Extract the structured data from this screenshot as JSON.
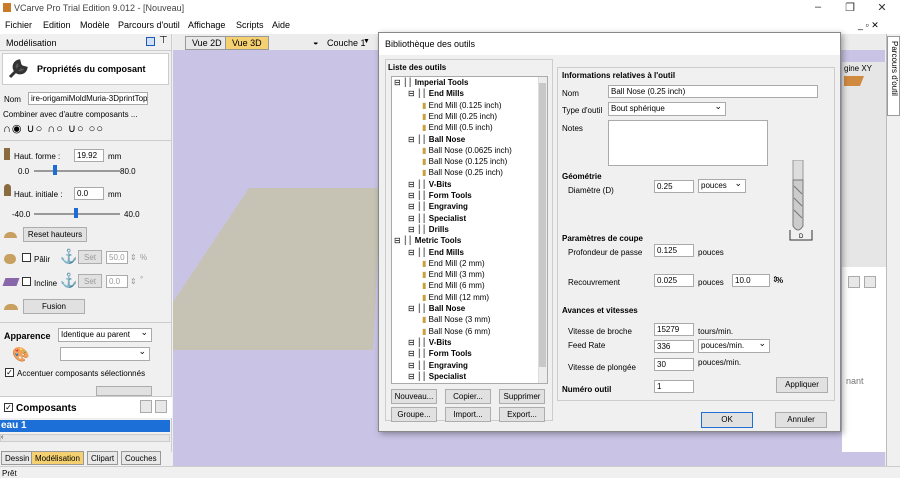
{
  "app": {
    "title": "VCarve Pro Trial Edition 9.012 - [Nouveau]",
    "status": "Prêt"
  },
  "menu": [
    "Fichier",
    "Edition",
    "Modèle",
    "Parcours d'outil",
    "Affichage",
    "Scripts",
    "Aide"
  ],
  "left": {
    "header": "Modélisation",
    "props_title": "Propriétés du composant",
    "name_label": "Nom",
    "name_value": "ire-origamiMoldMuria-3DprintTop",
    "combine_label": "Combiner avec d'autre composants ...",
    "haut_forme_label": "Haut. forme :",
    "haut_forme": "19.92",
    "unit_mm": "mm",
    "slider1_min": "0.0",
    "slider1_max": "80.0",
    "haut_init_label": "Haut. initiale :",
    "haut_init": "0.0",
    "slider2_min": "-40.0",
    "slider2_max": "40.0",
    "reset_label": "Reset hauteurs",
    "palier_label": "Pâlir",
    "set": "Set",
    "palier_val": "50.0",
    "pct": "%",
    "incline_label": "Incline",
    "incline_val": "0.0",
    "deg": "°",
    "fusion": "Fusion",
    "apparence_label": "Apparence",
    "apparence_value": "Identique au parent",
    "accent_label": "Accentuer composants sélectionnés",
    "composants_label": "Composants",
    "niveau": "eau 1",
    "tabs": [
      "Dessin",
      "Modélisation",
      "Clipart",
      "Couches"
    ]
  },
  "view": {
    "tab2d": "Vue 2D",
    "tab3d": "Vue 3D",
    "couche": "Couche 1",
    "right_label": "gine XY",
    "right_text": "nant",
    "right_tab": "Parcours d'outil"
  },
  "dialog": {
    "title": "Bibliothèque des outils",
    "list_title": "Liste des outils",
    "tree": [
      {
        "t": "Imperial Tools",
        "lvl": 0,
        "bold": true
      },
      {
        "t": "End Mills",
        "lvl": 1,
        "bold": true
      },
      {
        "t": "End Mill (0.125 inch)",
        "lvl": 2
      },
      {
        "t": "End Mill (0.25 inch)",
        "lvl": 2
      },
      {
        "t": "End Mill (0.5 inch)",
        "lvl": 2
      },
      {
        "t": "Ball Nose",
        "lvl": 1,
        "bold": true
      },
      {
        "t": "Ball Nose (0.0625 inch)",
        "lvl": 2
      },
      {
        "t": "Ball Nose (0.125 inch)",
        "lvl": 2
      },
      {
        "t": "Ball Nose (0.25 inch)",
        "lvl": 2
      },
      {
        "t": "V-Bits",
        "lvl": 1,
        "bold": true
      },
      {
        "t": "Form Tools",
        "lvl": 1,
        "bold": true
      },
      {
        "t": "Engraving",
        "lvl": 1,
        "bold": true
      },
      {
        "t": "Specialist",
        "lvl": 1,
        "bold": true
      },
      {
        "t": "Drills",
        "lvl": 1,
        "bold": true
      },
      {
        "t": "Metric Tools",
        "lvl": 0,
        "bold": true
      },
      {
        "t": "End Mills",
        "lvl": 1,
        "bold": true
      },
      {
        "t": "End Mill (2 mm)",
        "lvl": 2
      },
      {
        "t": "End Mill (3 mm)",
        "lvl": 2
      },
      {
        "t": "End Mill (6 mm)",
        "lvl": 2
      },
      {
        "t": "End Mill (12 mm)",
        "lvl": 2
      },
      {
        "t": "Ball Nose",
        "lvl": 1,
        "bold": true
      },
      {
        "t": "Ball Nose (3 mm)",
        "lvl": 2
      },
      {
        "t": "Ball Nose (6 mm)",
        "lvl": 2
      },
      {
        "t": "V-Bits",
        "lvl": 1,
        "bold": true
      },
      {
        "t": "Form Tools",
        "lvl": 1,
        "bold": true
      },
      {
        "t": "Engraving",
        "lvl": 1,
        "bold": true
      },
      {
        "t": "Specialist",
        "lvl": 1,
        "bold": true
      }
    ],
    "buttons": {
      "nouveau": "Nouveau...",
      "copier": "Copier...",
      "supprimer": "Supprimer",
      "groupe": "Groupe...",
      "import": "Import...",
      "export": "Export...",
      "ok": "OK",
      "annuler": "Annuler",
      "appliquer": "Appliquer"
    },
    "info_title": "Informations relatives à l'outil",
    "nom_label": "Nom",
    "nom": "Ball Nose (0.25 inch)",
    "type_label": "Type d'outil",
    "type": "Bout sphérique",
    "notes_label": "Notes",
    "geo_title": "Géométrie",
    "diam_label": "Diamètre (D)",
    "diam": "0.25",
    "unit_pouces": "pouces",
    "coupe_title": "Paramètres de coupe",
    "prof_label": "Profondeur de passe",
    "prof": "0.125",
    "recouv_label": "Recouvrement",
    "recouv": "0.025",
    "recouv_pct": "10.0",
    "pct": "%",
    "vit_title": "Avances et vitesses",
    "broche_label": "Vitesse de broche",
    "broche": "15279",
    "broche_unit": "tours/min.",
    "feed_label": "Feed Rate",
    "feed": "336",
    "feed_unit": "pouces/min.",
    "plong_label": "Vitesse de plongée",
    "plong": "30",
    "plong_unit": "pouces/min.",
    "numero_label": "Numéro outil",
    "numero": "1"
  }
}
